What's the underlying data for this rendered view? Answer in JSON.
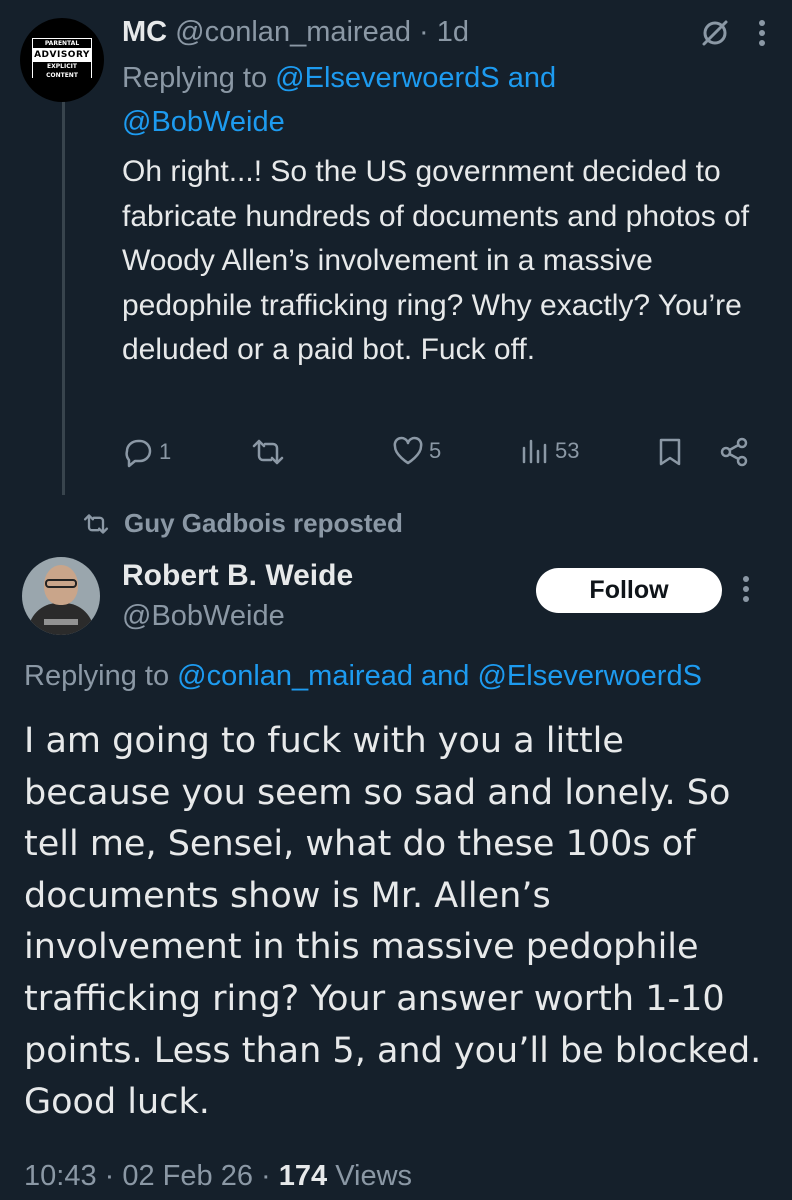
{
  "tweet1": {
    "avatar": {
      "top": "PARENTAL",
      "middle": "ADVISORY",
      "bottom": "EXPLICIT CONTENT"
    },
    "name": "MC",
    "handle": "@conlan_mairead",
    "time": "1d",
    "replying_label": "Replying to",
    "replying_users": [
      "@ElseverwoerdS",
      "@BobWeide"
    ],
    "replying_and": "and",
    "text": "Oh right...! So the US government decided to fabricate hundreds of documents and photos of Woody Allen’s involvement in a massive pedophile trafficking ring? Why exactly? You’re deluded or a paid bot. Fuck off.",
    "actions": {
      "replies": "1",
      "reposts": "",
      "likes": "5",
      "views": "53"
    },
    "icons": [
      "grok-icon",
      "more-icon",
      "reply-icon",
      "repost-icon",
      "like-icon",
      "views-icon",
      "bookmark-icon",
      "share-icon"
    ]
  },
  "repost": {
    "label": "Guy Gadbois reposted"
  },
  "tweet2": {
    "name": "Robert B. Weide",
    "handle": "@BobWeide",
    "follow_label": "Follow",
    "replying_label": "Replying to",
    "replying_users": [
      "@conlan_mairead",
      "@ElseverwoerdS"
    ],
    "replying_and": "and",
    "text": "I am going to fuck with you a little because you seem so sad and lonely. So tell me, Sensei, what do these 100s of documents show is Mr. Allen’s involvement in this massive pedophile trafficking ring? Your answer worth 1-10 points. Less than 5, and you’ll be blocked. Good luck.",
    "time": "10:43",
    "date": "02 Feb 26",
    "views_count": "174",
    "views_label": "Views"
  },
  "colors": {
    "background": "#15202b",
    "text": "#e7e9ea",
    "muted": "#8b98a5",
    "link": "#1d9bf0"
  }
}
